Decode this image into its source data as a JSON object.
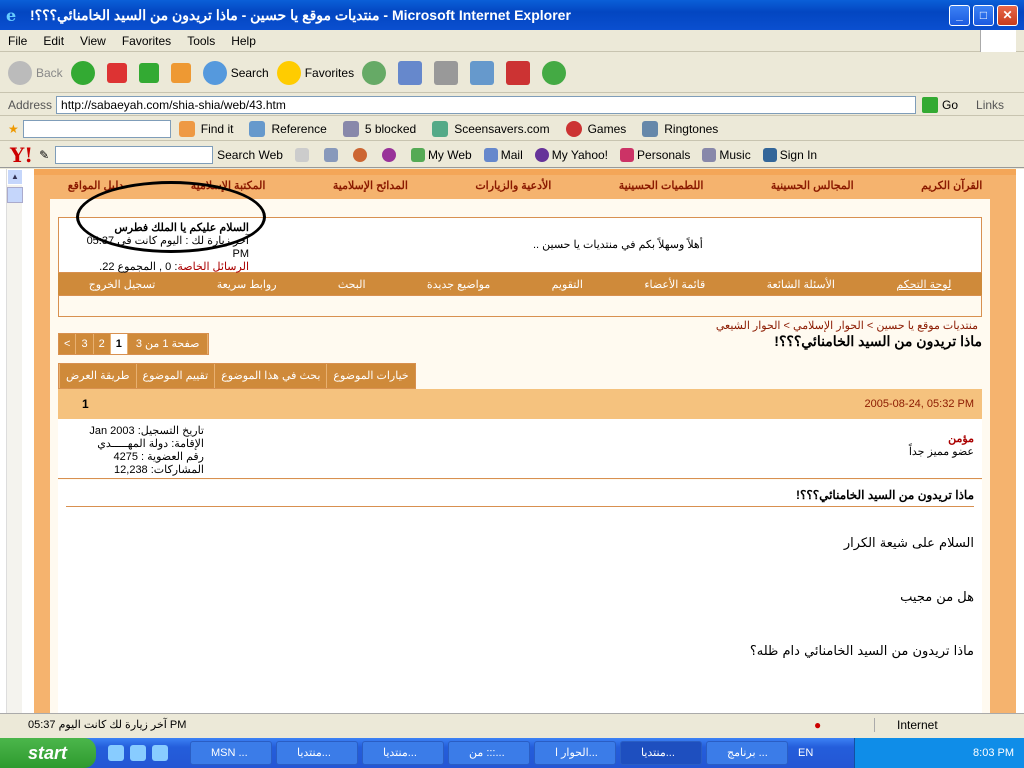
{
  "window": {
    "title": "!منتديات موقع يا حسين - ماذا تريدون من السيد الخامنائي؟؟؟ - Microsoft Internet Explorer",
    "menu": [
      "File",
      "Edit",
      "View",
      "Favorites",
      "Tools",
      "Help"
    ]
  },
  "toolbar": {
    "back": "Back",
    "search": "Search",
    "favorites": "Favorites"
  },
  "address": {
    "label": "Address",
    "url": "http://sabaeyah.com/shia-shia/web/43.htm",
    "go": "Go",
    "links": "Links"
  },
  "linksbar": {
    "find": "Find it",
    "reference": "Reference",
    "blocked": "5 blocked",
    "screensavers": "Sceensavers.com",
    "games": "Games",
    "ringtones": "Ringtones"
  },
  "yahoobar": {
    "search_web": "Search Web",
    "my_web": "My Web",
    "mail": "Mail",
    "my_yahoo": "My Yahoo!",
    "personals": "Personals",
    "music": "Music",
    "sign_in": "Sign In"
  },
  "site_nav": [
    "القرآن الكريم",
    "المجالس الحسينية",
    "اللطميات الحسينية",
    "الأدعية والزيارات",
    "المدائح الإسلامية",
    "المكتبة الإسلامية",
    "دليل المواقع"
  ],
  "welcome": {
    "greeting": "أهلاً وسهلاً بكم في منتديات يا حسين ..",
    "hello_user": "السلام عليكم يا الملك فطرس",
    "last_visit": "آخر زيارة لك : اليوم كانت في 05:37 PM",
    "pm": "الرسائل الخاصة",
    "pm_counts": ": 0 , المجموع 22."
  },
  "forum_nav": [
    "لوحة التحكم",
    "الأسئلة الشائعة",
    "قائمة الأعضاء",
    "التقويم",
    "مواضيع جديدة",
    "البحث",
    "روابط سريعة",
    "تسجيل الخروج"
  ],
  "breadcrumb": "منتديات موقع يا حسين > الحوار الإسلامي > الحوار الشيعي",
  "thread_title": "ماذا تريدون من السيد الخامنائي؟؟؟!",
  "pager": {
    "label": "صفحة 1 من 3",
    "pages": [
      "1",
      "2",
      "3"
    ],
    "next": "<"
  },
  "thread_tools": [
    "خيارات الموضوع",
    "بحث في هذا الموضوع",
    "تقييم الموضوع",
    "طريقة العرض"
  ],
  "post": {
    "number": "1",
    "date": "2005-08-24, 05:32 PM",
    "username": "مؤمن",
    "user_title": "عضو مميز جداً",
    "join_date": "تاريخ التسجيل: Jan 2003",
    "location": "الإقامة: دولة المهـــــدي",
    "member_no": "رقم العضوية : 4275",
    "posts": "المشاركات: 12,238",
    "title": "ماذا تريدون من السيد الخامنائي؟؟؟!",
    "lines": [
      "السلام على شيعة الكرار",
      "هل من مجيب",
      "ماذا تريدون من السيد الخامنائي دام ظله؟"
    ]
  },
  "status": {
    "text": "آخر زيارة لك كانت اليوم 05:37 PM",
    "zone": "Internet"
  },
  "taskbar": {
    "start": "start",
    "tasks": [
      "MSN ...",
      "منتديا...",
      "منتديا...",
      "من :::...",
      "الحوار ا...",
      "منتديا...",
      "برنامج ..."
    ],
    "lang": "EN",
    "clock": "8:03 PM"
  }
}
